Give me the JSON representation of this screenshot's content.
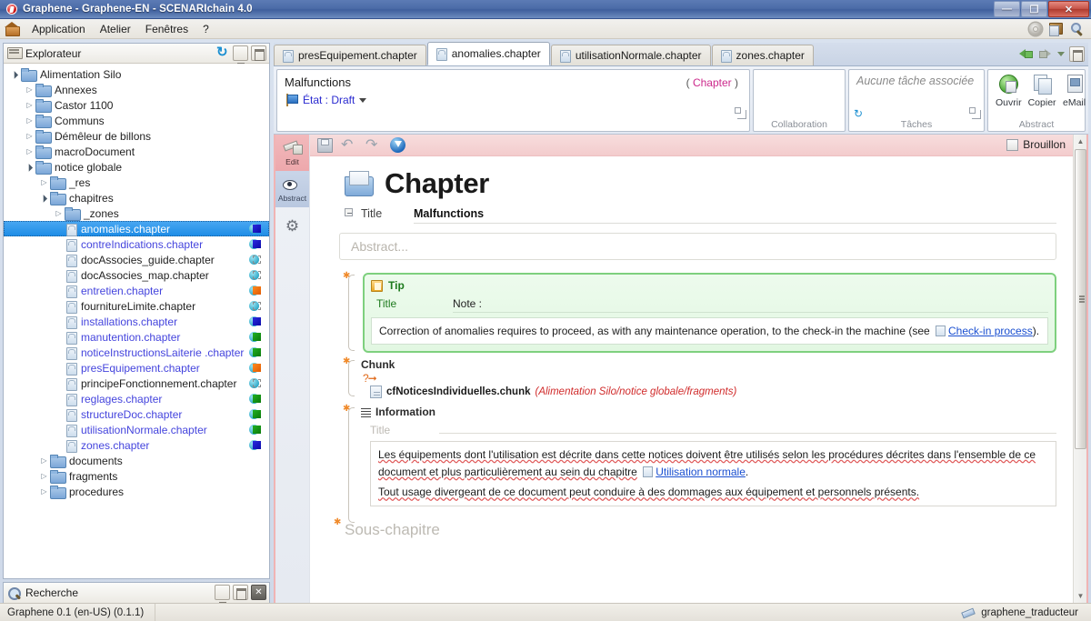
{
  "window": {
    "title": "Graphene - Graphene-EN - SCENARIchain 4.0",
    "minimize_label": "—",
    "restore_label": "❐",
    "close_label": "✕"
  },
  "menubar": {
    "items": [
      "Application",
      "Atelier",
      "Fenêtres",
      "?"
    ],
    "right_icons": [
      "gear-icon",
      "workshop-icon",
      "search-icon"
    ]
  },
  "explorer": {
    "title": "Explorateur",
    "tools": [
      "refresh-icon",
      "minimize-icon",
      "maximize-icon"
    ],
    "tree": [
      {
        "label": "Alimentation Silo",
        "depth": 0,
        "kind": "folder",
        "twist": "open",
        "link": false,
        "dot": null,
        "selected": false
      },
      {
        "label": "Annexes",
        "depth": 1,
        "kind": "folder",
        "twist": "closed",
        "link": false,
        "dot": null,
        "selected": false
      },
      {
        "label": "Castor 1100",
        "depth": 1,
        "kind": "folder",
        "twist": "closed",
        "link": false,
        "dot": null,
        "selected": false
      },
      {
        "label": "Communs",
        "depth": 1,
        "kind": "folder",
        "twist": "closed",
        "link": false,
        "dot": null,
        "selected": false
      },
      {
        "label": "Démêleur de billons",
        "depth": 1,
        "kind": "folder",
        "twist": "closed",
        "link": false,
        "dot": null,
        "selected": false
      },
      {
        "label": "macroDocument",
        "depth": 1,
        "kind": "folder",
        "twist": "closed",
        "link": false,
        "dot": null,
        "selected": false
      },
      {
        "label": "notice globale",
        "depth": 1,
        "kind": "folder",
        "twist": "open",
        "link": false,
        "dot": null,
        "selected": false
      },
      {
        "label": "_res",
        "depth": 2,
        "kind": "folder",
        "twist": "closed",
        "link": false,
        "dot": null,
        "selected": false
      },
      {
        "label": "chapitres",
        "depth": 2,
        "kind": "folder",
        "twist": "open",
        "link": false,
        "dot": null,
        "selected": false
      },
      {
        "label": "_zones",
        "depth": 3,
        "kind": "folder",
        "twist": "closed",
        "link": false,
        "dot": null,
        "selected": false
      },
      {
        "label": "anomalies.chapter",
        "depth": 3,
        "kind": "file",
        "twist": "",
        "link": true,
        "dot": "blue",
        "selected": true
      },
      {
        "label": "contreIndications.chapter",
        "depth": 3,
        "kind": "file",
        "twist": "",
        "link": true,
        "dot": "blue",
        "selected": false
      },
      {
        "label": "docAssocies_guide.chapter",
        "depth": 3,
        "kind": "file",
        "twist": "",
        "link": false,
        "dot": "dash",
        "selected": false
      },
      {
        "label": "docAssocies_map.chapter",
        "depth": 3,
        "kind": "file",
        "twist": "",
        "link": false,
        "dot": "dash",
        "selected": false
      },
      {
        "label": "entretien.chapter",
        "depth": 3,
        "kind": "file",
        "twist": "",
        "link": true,
        "dot": "orange",
        "selected": false
      },
      {
        "label": "fournitureLimite.chapter",
        "depth": 3,
        "kind": "file",
        "twist": "",
        "link": false,
        "dot": "dash",
        "selected": false
      },
      {
        "label": "installations.chapter",
        "depth": 3,
        "kind": "file",
        "twist": "",
        "link": true,
        "dot": "blue",
        "selected": false
      },
      {
        "label": "manutention.chapter",
        "depth": 3,
        "kind": "file",
        "twist": "",
        "link": true,
        "dot": "green",
        "selected": false
      },
      {
        "label": "noticeInstructionsLaiterie .chapter",
        "depth": 3,
        "kind": "file",
        "twist": "",
        "link": true,
        "dot": "green",
        "selected": false
      },
      {
        "label": "presEquipement.chapter",
        "depth": 3,
        "kind": "file",
        "twist": "",
        "link": true,
        "dot": "orange",
        "selected": false
      },
      {
        "label": "principeFonctionnement.chapter",
        "depth": 3,
        "kind": "file",
        "twist": "",
        "link": false,
        "dot": "dash",
        "selected": false
      },
      {
        "label": "reglages.chapter",
        "depth": 3,
        "kind": "file",
        "twist": "",
        "link": true,
        "dot": "green",
        "selected": false
      },
      {
        "label": "structureDoc.chapter",
        "depth": 3,
        "kind": "file",
        "twist": "",
        "link": true,
        "dot": "green",
        "selected": false
      },
      {
        "label": "utilisationNormale.chapter",
        "depth": 3,
        "kind": "file",
        "twist": "",
        "link": true,
        "dot": "green",
        "selected": false
      },
      {
        "label": "zones.chapter",
        "depth": 3,
        "kind": "file",
        "twist": "",
        "link": true,
        "dot": "blue",
        "selected": false
      },
      {
        "label": "documents",
        "depth": 2,
        "kind": "folder",
        "twist": "closed",
        "link": false,
        "dot": null,
        "selected": false
      },
      {
        "label": "fragments",
        "depth": 2,
        "kind": "folder",
        "twist": "closed",
        "link": false,
        "dot": null,
        "selected": false
      },
      {
        "label": "procedures",
        "depth": 2,
        "kind": "folder",
        "twist": "closed",
        "link": false,
        "dot": null,
        "selected": false
      }
    ]
  },
  "search_panel": {
    "title": "Recherche",
    "tools": [
      "minimize-icon",
      "maximize-icon",
      "close-icon"
    ]
  },
  "tabs": [
    {
      "label": "presEquipement.chapter",
      "active": false
    },
    {
      "label": "anomalies.chapter",
      "active": true
    },
    {
      "label": "utilisationNormale.chapter",
      "active": false
    },
    {
      "label": "zones.chapter",
      "active": false
    }
  ],
  "tab_nav": {
    "back": "back-arrow-icon",
    "forward": "forward-arrow-icon",
    "dropdown": "chevron-down-icon",
    "restore": "restore-icon"
  },
  "ribbon": {
    "doc_title": "Malfunctions",
    "type_open": "(",
    "type_label": "Chapter",
    "type_close": ")",
    "state_label": "État : Draft",
    "collaboration_caption": "Collaboration",
    "task_placeholder": "Aucune tâche associée",
    "tasks_caption": "Tâches",
    "abstract_caption": "Abstract",
    "abstract_actions": [
      {
        "label": "Ouvrir",
        "icon": "open-icon"
      },
      {
        "label": "Copier",
        "icon": "copy-icon"
      },
      {
        "label": "eMail",
        "icon": "mail-icon"
      }
    ]
  },
  "vtabs": [
    {
      "label": "Edit",
      "icon": "pencil-tag-icon",
      "active": true
    },
    {
      "label": "Abstract",
      "icon": "eye-tag-icon",
      "active": false
    },
    {
      "label": "",
      "icon": "gear-icon",
      "active": false
    }
  ],
  "editor_toolbar": {
    "buttons": [
      "save-icon",
      "undo-icon",
      "redo-icon",
      "info-icon"
    ],
    "draft_checkbox_label": "Brouillon",
    "draft_checked": false
  },
  "document": {
    "heading": "Chapter",
    "title_label": "Title",
    "title_value": "Malfunctions",
    "abstract_placeholder": "Abstract...",
    "tip": {
      "header": "Tip",
      "title_label": "Title",
      "title_value": "Note :",
      "body_before": "Correction of anomalies requires to proceed, as with any maintenance operation, to the check-in the machine (see",
      "link": "Check-in process",
      "body_after": ")."
    },
    "chunk": {
      "label": "Chunk",
      "file": "cfNoticesIndividuelles.chunk",
      "path": "(Alimentation Silo/notice globale/fragments)"
    },
    "information": {
      "label": "Information",
      "title_label": "Title",
      "paragraph1_before": "Les équipements dont l'utilisation est décrite dans cette notices doivent être utilisés selon les procédures décrites dans l'ensemble de ce document et plus particulièrement au sein du chapitre",
      "paragraph1_link": "Utilisation normale",
      "paragraph1_after": ".",
      "paragraph2": "Tout usage divergeant de ce document peut conduire à des dommages aux équipement et personnels présents."
    },
    "subchapter_placeholder": "Sous-chapitre"
  },
  "statusbar": {
    "left": "Graphene 0.1 (en-US) (0.1.1)",
    "user": "graphene_traducteur"
  }
}
